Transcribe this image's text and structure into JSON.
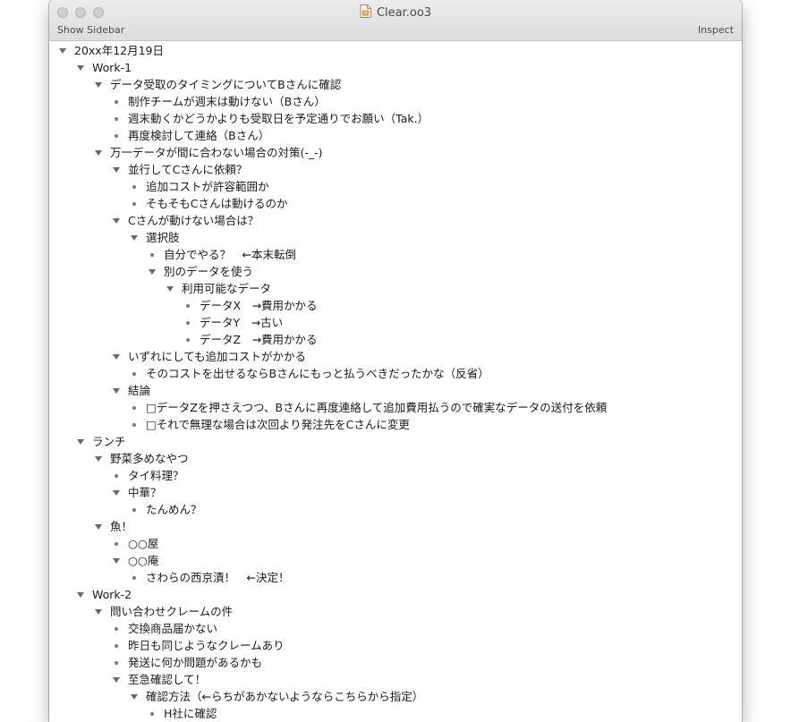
{
  "window": {
    "title": "Clear.oo3",
    "show_sidebar": "Show Sidebar",
    "inspect": "Inspect"
  },
  "outline": [
    {
      "text": "20xx年12月19日",
      "level": 0,
      "type": "parent"
    },
    {
      "text": "Work-1",
      "level": 1,
      "type": "parent"
    },
    {
      "text": "データ受取のタイミングについてBさんに確認",
      "level": 2,
      "type": "parent"
    },
    {
      "text": "制作チームが週末は動けない（Bさん）",
      "level": 3,
      "type": "leaf"
    },
    {
      "text": "週末動くかどうかよりも受取日を予定通りでお願い（Tak.）",
      "level": 3,
      "type": "leaf"
    },
    {
      "text": "再度検討して連絡（Bさん）",
      "level": 3,
      "type": "leaf"
    },
    {
      "text": "万一データが間に合わない場合の対策(-_-)",
      "level": 2,
      "type": "parent"
    },
    {
      "text": "並行してCさんに依頼？",
      "level": 3,
      "type": "parent"
    },
    {
      "text": "追加コストが許容範囲か",
      "level": 4,
      "type": "leaf"
    },
    {
      "text": "そもそもCさんは動けるのか",
      "level": 4,
      "type": "leaf"
    },
    {
      "text": "Cさんが動けない場合は？",
      "level": 3,
      "type": "parent"
    },
    {
      "text": "選択肢",
      "level": 4,
      "type": "parent"
    },
    {
      "text": "自分でやる？　←本末転倒",
      "level": 5,
      "type": "leaf"
    },
    {
      "text": "別のデータを使う",
      "level": 5,
      "type": "parent"
    },
    {
      "text": "利用可能なデータ",
      "level": 6,
      "type": "parent"
    },
    {
      "text": "データX　→費用かかる",
      "level": 7,
      "type": "leaf"
    },
    {
      "text": "データY　→古い",
      "level": 7,
      "type": "leaf"
    },
    {
      "text": "データZ　→費用かかる",
      "level": 7,
      "type": "leaf"
    },
    {
      "text": "いずれにしても追加コストがかかる",
      "level": 3,
      "type": "parent"
    },
    {
      "text": "そのコストを出せるならBさんにもっと払うべきだったかな（反省）",
      "level": 4,
      "type": "leaf"
    },
    {
      "text": "結論",
      "level": 3,
      "type": "parent"
    },
    {
      "text": "□データZを押さえつつ、Bさんに再度連絡して追加費用払うので確実なデータの送付を依頼",
      "level": 4,
      "type": "leaf"
    },
    {
      "text": "□それで無理な場合は次回より発注先をCさんに変更",
      "level": 4,
      "type": "leaf"
    },
    {
      "text": "ランチ",
      "level": 1,
      "type": "parent"
    },
    {
      "text": "野菜多めなやつ",
      "level": 2,
      "type": "parent"
    },
    {
      "text": "タイ料理？",
      "level": 3,
      "type": "leaf"
    },
    {
      "text": "中華？",
      "level": 3,
      "type": "parent"
    },
    {
      "text": "たんめん？",
      "level": 4,
      "type": "leaf"
    },
    {
      "text": "魚！",
      "level": 2,
      "type": "parent"
    },
    {
      "text": "○○屋",
      "level": 3,
      "type": "leaf"
    },
    {
      "text": "○○庵",
      "level": 3,
      "type": "parent"
    },
    {
      "text": "さわらの西京漬！　←決定！",
      "level": 4,
      "type": "leaf"
    },
    {
      "text": "Work-2",
      "level": 1,
      "type": "parent"
    },
    {
      "text": "問い合わせクレームの件",
      "level": 2,
      "type": "parent"
    },
    {
      "text": "交換商品届かない",
      "level": 3,
      "type": "leaf"
    },
    {
      "text": "昨日も同じようなクレームあり",
      "level": 3,
      "type": "leaf"
    },
    {
      "text": "発送に何か問題があるかも",
      "level": 3,
      "type": "leaf"
    },
    {
      "text": "至急確認して！",
      "level": 3,
      "type": "parent"
    },
    {
      "text": "確認方法（←らちがあかないようならこちらから指定）",
      "level": 4,
      "type": "parent"
    },
    {
      "text": "H社に確認",
      "level": 5,
      "type": "leaf"
    }
  ]
}
